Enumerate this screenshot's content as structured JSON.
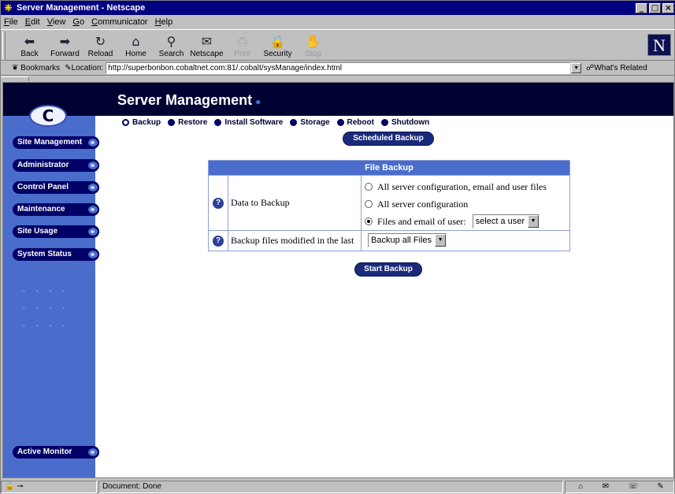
{
  "window": {
    "title": "Server Management - Netscape"
  },
  "menu": [
    "File",
    "Edit",
    "View",
    "Go",
    "Communicator",
    "Help"
  ],
  "toolbar": [
    {
      "label": "Back",
      "icon": "back-arrow-icon",
      "glyph": "⬅",
      "enabled": true
    },
    {
      "label": "Forward",
      "icon": "forward-arrow-icon",
      "glyph": "➡",
      "enabled": true
    },
    {
      "label": "Reload",
      "icon": "reload-icon",
      "glyph": "↻",
      "enabled": true
    },
    {
      "label": "Home",
      "icon": "home-icon",
      "glyph": "⌂",
      "enabled": true
    },
    {
      "label": "Search",
      "icon": "search-icon",
      "glyph": "⚲",
      "enabled": true
    },
    {
      "label": "Netscape",
      "icon": "netscape-icon",
      "glyph": "✉",
      "enabled": true
    },
    {
      "label": "Print",
      "icon": "print-icon",
      "glyph": "⎙",
      "enabled": false
    },
    {
      "label": "Security",
      "icon": "lock-icon",
      "glyph": "🔒",
      "enabled": true
    },
    {
      "label": "Stop",
      "icon": "stop-icon",
      "glyph": "✋",
      "enabled": false
    }
  ],
  "location": {
    "bookmarks_label": "Bookmarks",
    "label": "Location:",
    "url": "http://superbonbon.cobaltnet.com:81/.cobalt/sysManage/index.html",
    "related_label": "What's Related"
  },
  "page": {
    "title": "Server Management",
    "sidebar": [
      "Site Management",
      "Administrator",
      "Control Panel",
      "Maintenance",
      "Site Usage",
      "System Status"
    ],
    "active_monitor": "Active Monitor",
    "subnav": [
      "Backup",
      "Restore",
      "Install Software",
      "Storage",
      "Reboot",
      "Shutdown"
    ],
    "scheduled_backup": "Scheduled Backup",
    "table": {
      "title": "File Backup",
      "row1_label": "Data to Backup",
      "options": [
        "All server configuration, email and user files",
        "All server configuration",
        "Files and email of user:"
      ],
      "selected_option": 2,
      "user_select": "select a user",
      "row2_label": "Backup files modified in the last",
      "modified_select": "Backup all Files"
    },
    "start_backup": "Start Backup"
  },
  "status": {
    "text": "Document: Done"
  },
  "colors": {
    "sidebar": "#4a6dcc",
    "banner": "#000033",
    "button": "#1a2a7a"
  }
}
